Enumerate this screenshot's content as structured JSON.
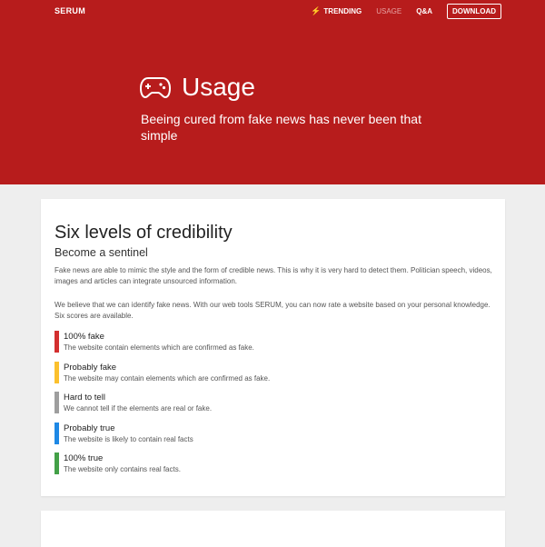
{
  "header": {
    "brand": "SERUM",
    "nav": {
      "trending": "TRENDING",
      "usage": "USAGE",
      "qa": "Q&A",
      "download": "DOWNLOAD"
    }
  },
  "hero": {
    "icon": "gamepad-icon",
    "title": "Usage",
    "subtitle": "Beeing cured from fake news has never been that simple"
  },
  "section": {
    "title": "Six levels of credibility",
    "subtitle": "Become a sentinel",
    "paragraphs": [
      "Fake news are able to mimic the style and the form of credible news. This is why it is very hard to detect them. Politician speech, videos, images and articles can integrate unsourced information.",
      "We believe that we can identify fake news. With our web tools SERUM, you can now rate a website based on your personal knowledge. Six scores are available."
    ],
    "levels": [
      {
        "title": "100% fake",
        "description": "The website contain elements which are confirmed as fake.",
        "color": "#d32f2f"
      },
      {
        "title": "Probably fake",
        "description": "The website may contain elements which are confirmed as fake.",
        "color": "#fbc02d"
      },
      {
        "title": "Hard to tell",
        "description": "We cannot tell if the elements are real or fake.",
        "color": "#9e9e9e"
      },
      {
        "title": "Probably true",
        "description": "The website is likely to contain real facts",
        "color": "#1e88e5"
      },
      {
        "title": "100% true",
        "description": "The website only contains real facts.",
        "color": "#43a047"
      }
    ]
  },
  "colors": {
    "hero_background": "#b71c1c",
    "page_background": "#eeeeee"
  }
}
